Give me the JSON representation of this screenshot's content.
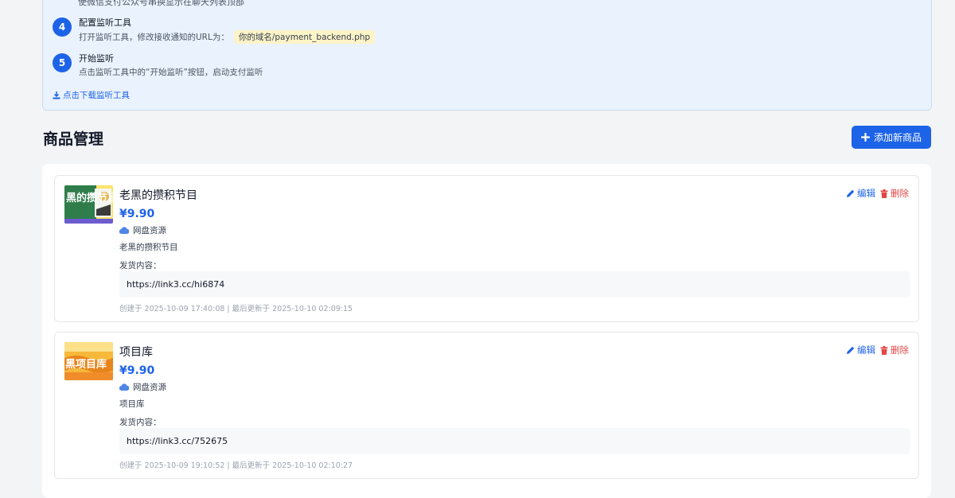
{
  "guide": {
    "cut_text": "使微信支付公众号串换显示在聊天列表顶部",
    "steps": [
      {
        "num": "4",
        "title": "配置监听工具",
        "desc": "打开监听工具，修改接收通知的URL为：",
        "code": "你的域名/payment_backend.php"
      },
      {
        "num": "5",
        "title": "开始监听",
        "desc": "点击监听工具中的“开始监听”按钮，启动支付监听"
      }
    ],
    "download_label": "点击下载监听工具"
  },
  "section": {
    "title": "商品管理",
    "add_button": "添加新商品"
  },
  "products": [
    {
      "name": "老黑的攒积节目",
      "price": "¥9.90",
      "type": "网盘资源",
      "description": "老黑的攒积节目",
      "content_label": "发货内容：",
      "content": "https://link3.cc/hi6874",
      "meta": "创建于 2025-10-09 17:40:08 | 最后更新于 2025-10-10 02:09:15",
      "edit_label": "编辑",
      "delete_label": "删除",
      "thumb_text": "黑的攒节目"
    },
    {
      "name": "项目库",
      "price": "¥9.90",
      "type": "网盘资源",
      "description": "项目库",
      "content_label": "发货内容：",
      "content": "https://link3.cc/752675",
      "meta": "创建于 2025-10-09 19:10:52 | 最后更新于 2025-10-10 02:10:27",
      "edit_label": "编辑",
      "delete_label": "删除",
      "thumb_text": "黑项目库"
    }
  ],
  "colors": {
    "accent": "#1d63e8",
    "danger": "#e24646",
    "code_bg": "#fcf3c7",
    "guide_bg": "#eaf2fd"
  },
  "icons": {
    "download": "download-icon",
    "plus": "plus-icon",
    "cloud": "cloud-icon",
    "edit": "pencil-icon",
    "delete": "trash-icon"
  }
}
